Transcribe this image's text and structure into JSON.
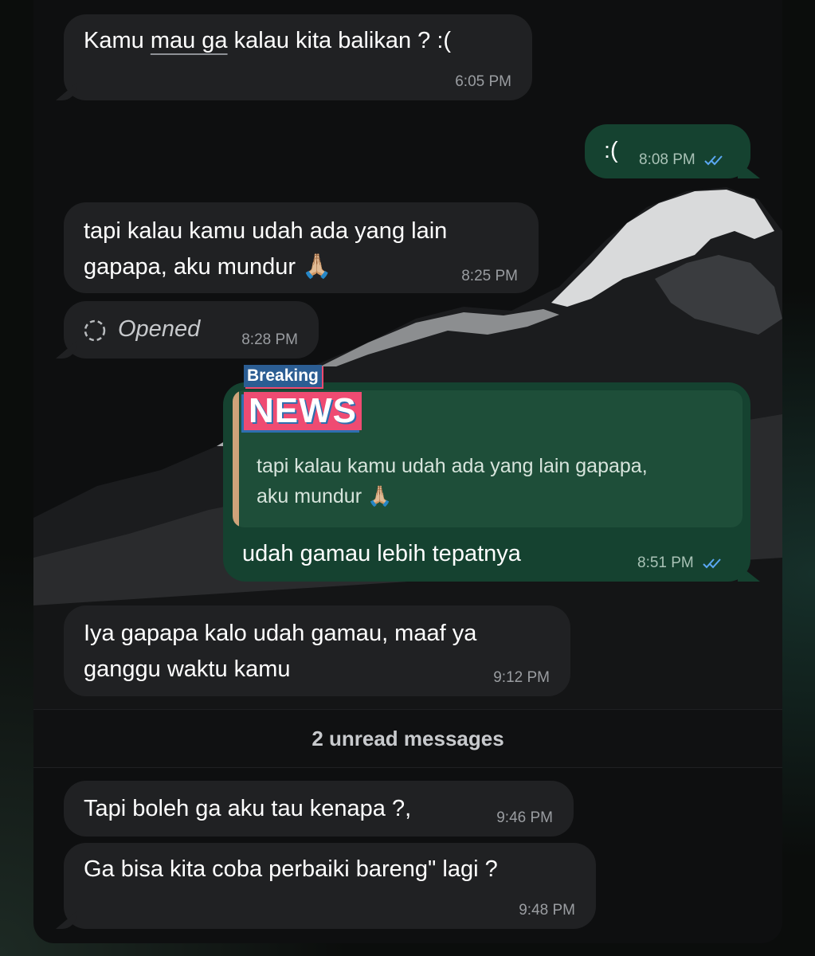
{
  "messages": [
    {
      "text_plain": "Kamu ",
      "text_underlined": "mau ga",
      "text_after": " kalau kita balikan ? :(",
      "time": "6:05 PM"
    },
    {
      "text": ":(",
      "time": "8:08 PM"
    },
    {
      "line1": "tapi kalau kamu udah ada yang lain",
      "line2": "gapapa, aku mundur",
      "emoji": "🙏🏼",
      "time": "8:25 PM"
    },
    {
      "text": "Opened",
      "time": "8:28 PM"
    },
    {
      "quote_line1": "tapi kalau kamu udah ada yang lain gapapa,",
      "quote_line2": "aku mundur",
      "quote_emoji": "🙏🏼",
      "text": "udah gamau lebih tepatnya",
      "time": "8:51 PM"
    },
    {
      "line1": "Iya gapapa kalo udah gamau, maaf ya",
      "line2": "ganggu waktu kamu",
      "time": "9:12 PM"
    },
    {
      "text": "Tapi boleh ga aku tau kenapa ?,",
      "time": "9:46 PM"
    },
    {
      "text": "Ga bisa kita coba perbaiki bareng\" lagi ?",
      "time": "9:48 PM"
    }
  ],
  "sticker": {
    "top": "Breaking",
    "bottom": "NEWS"
  },
  "divider": {
    "label": "2 unread messages"
  },
  "icons": {
    "read_receipt": "double-check-icon",
    "opened": "dashed-circle-icon"
  },
  "colors": {
    "incoming": "#202123",
    "outgoing": "#154230",
    "read_tick": "#5aa7f2"
  }
}
